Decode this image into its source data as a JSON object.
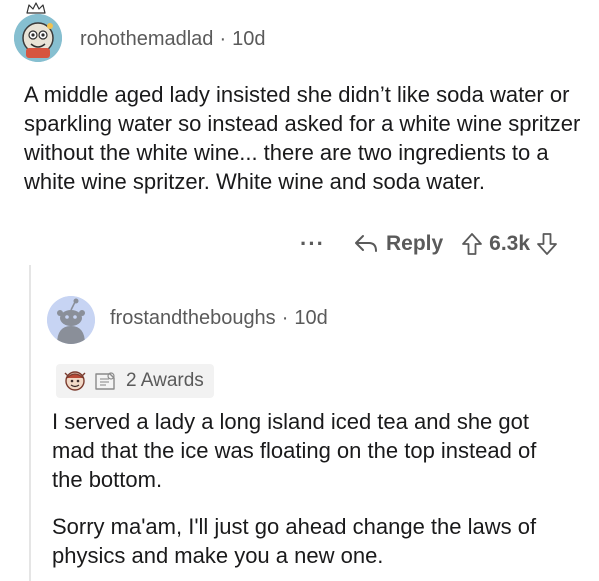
{
  "comment": {
    "author": "rohothemadlad",
    "age": "10d",
    "separator": "·",
    "text": "A middle aged lady insisted she didn’t like soda water or sparkling water so instead asked for a white wine spritzer without the white wine... there are two ingredients to a white wine spritzer. White wine and soda water.",
    "actions": {
      "more": "···",
      "reply_label": "Reply",
      "score": "6.3k"
    }
  },
  "reply": {
    "author": "frostandtheboughs",
    "age": "10d",
    "separator": "·",
    "awards_label": "2 Awards",
    "paragraph1": "I served a lady a long island iced tea and she got mad that the ice was floating on the top instead of the bottom.",
    "paragraph2": "Sorry ma'am, I'll just go ahead change the laws of physics and make you a new one."
  },
  "icons": {
    "reply": "reply-arrow-icon",
    "upvote": "upvote-arrow-icon",
    "downvote": "downvote-arrow-icon"
  },
  "colors": {
    "meta_text": "#5a5a5a",
    "body_text": "#1a1a1b",
    "avatar2_bg": "#c7d4f3",
    "awards_bg": "#f2f2f2"
  }
}
